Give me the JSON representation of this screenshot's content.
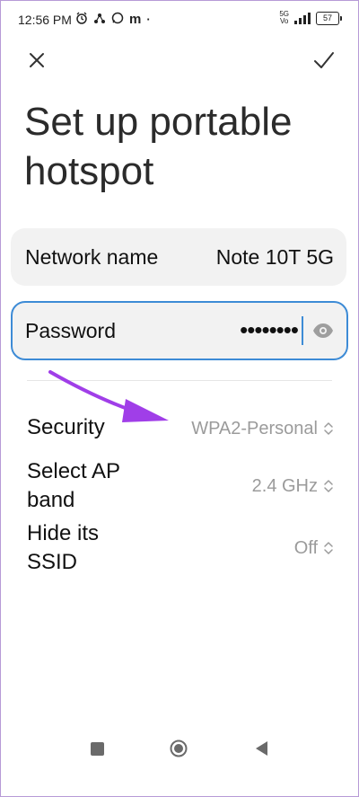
{
  "status_bar": {
    "time": "12:56 PM",
    "network_badge_top": "5G",
    "network_badge_bottom": "Vo",
    "battery": "57"
  },
  "header": {
    "close_icon": "close-icon",
    "confirm_icon": "checkmark-icon",
    "title": "Set up portable hotspot"
  },
  "form": {
    "network_name_label": "Network name",
    "network_name_value": "Note 10T 5G",
    "password_label": "Password",
    "password_value": "••••••••"
  },
  "settings": [
    {
      "label": "Security",
      "value": "WPA2-Personal"
    },
    {
      "label": "Select AP band",
      "value": "2.4 GHz"
    },
    {
      "label": "Hide its SSID",
      "value": "Off"
    }
  ],
  "colors": {
    "accent": "#3d8bd6",
    "annotation_arrow": "#a03ee8",
    "field_background": "#f2f2f2",
    "secondary_text": "#9b9b9b"
  }
}
